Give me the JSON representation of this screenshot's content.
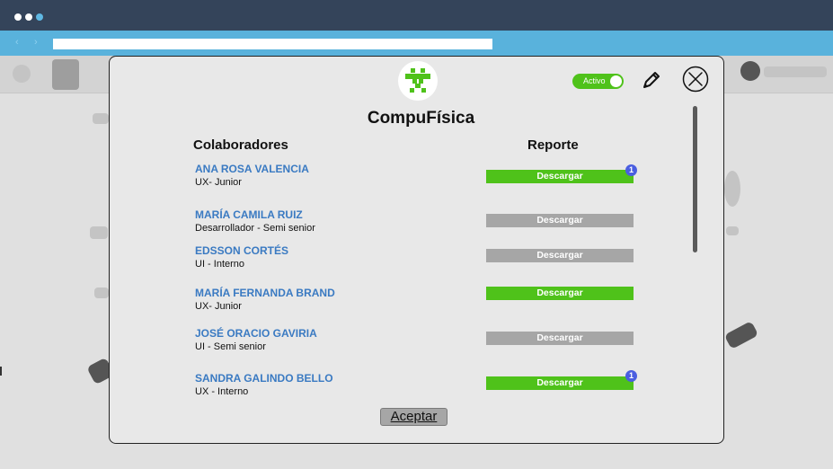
{
  "modal": {
    "title": "CompuFísica",
    "toggle_label": "Activo",
    "toggle_state": "on",
    "columns": {
      "left": "Colaboradores",
      "right": "Reporte"
    },
    "download_label": "Descargar",
    "accept_label": "Aceptar",
    "rows": [
      {
        "name": "ANA ROSA VALENCIA",
        "role": "UX- Junior",
        "download_enabled": true,
        "badge": "1"
      },
      {
        "name": "MARÍA CAMILA RUIZ",
        "role": "Desarrollador - Semi senior",
        "download_enabled": false
      },
      {
        "name": "EDSSON CORTÉS",
        "role": "UI - Interno",
        "download_enabled": false
      },
      {
        "name": "MARÍA FERNANDA BRAND",
        "role": "UX- Junior",
        "download_enabled": true
      },
      {
        "name": "JOSÉ ORACIO GAVIRIA",
        "role": "UI - Semi senior",
        "download_enabled": false
      },
      {
        "name": "SANDRA GALINDO BELLO",
        "role": "UX - Interno",
        "download_enabled": true,
        "badge": "1"
      }
    ]
  },
  "icons": {
    "logo": "compufisica-logo-icon",
    "edit": "pencil-icon",
    "close": "close-circle-icon",
    "back": "chevron-left-icon",
    "forward": "chevron-right-icon"
  },
  "colors": {
    "titlebar": "#34445a",
    "addressbar": "#59b2dc",
    "accent_green": "#4fc21a",
    "disabled_gray": "#a6a6a6",
    "name_blue": "#3a7ac2",
    "badge_blue": "#4a5ee0"
  }
}
